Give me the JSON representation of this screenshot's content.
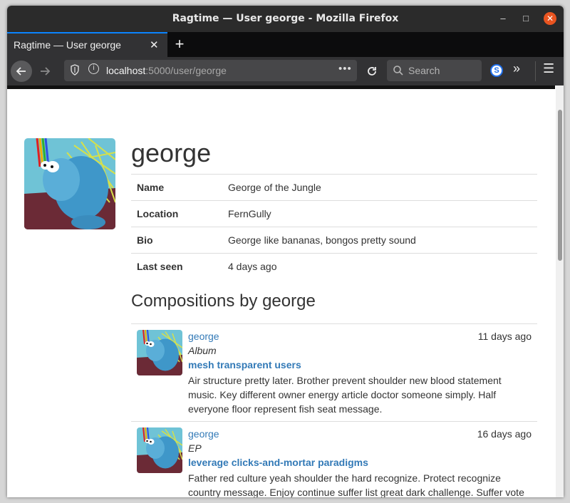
{
  "window": {
    "title": "Ragtime — User george - Mozilla Firefox",
    "controls": {
      "minimize": "–",
      "maximize": "□",
      "close": "✕"
    }
  },
  "tab": {
    "title": "Ragtime — User george",
    "close": "✕",
    "new_tab": "+"
  },
  "navbar": {
    "url_host": "localhost",
    "url_path": ":5000/user/george",
    "search_placeholder": "Search",
    "extension_letter": "S"
  },
  "profile": {
    "username": "george",
    "avatar_icon": "cartoon-blue-creature-avatar",
    "fields": [
      {
        "key": "Name",
        "value": "George of the Jungle"
      },
      {
        "key": "Location",
        "value": "FernGully"
      },
      {
        "key": "Bio",
        "value": "George like bananas, bongos pretty sound"
      },
      {
        "key": "Last seen",
        "value": "4 days ago"
      }
    ]
  },
  "compositions": {
    "heading": "Compositions by george",
    "items": [
      {
        "user": "george",
        "time": "11 days ago",
        "type": "Album",
        "title": "mesh transparent users",
        "description": "Air structure pretty later. Brother prevent shoulder new blood statement music. Key different owner energy article doctor someone simply. Half everyone floor represent fish seat message."
      },
      {
        "user": "george",
        "time": "16 days ago",
        "type": "EP",
        "title": "leverage clicks-and-mortar paradigms",
        "description": "Father red culture yeah shoulder the hard recognize. Protect recognize country message. Enjoy continue suffer list great dark challenge. Suffer vote"
      }
    ]
  },
  "colors": {
    "link": "#337ab7",
    "text": "#333333",
    "accent": "#0a84ff",
    "close_button": "#e95420"
  }
}
